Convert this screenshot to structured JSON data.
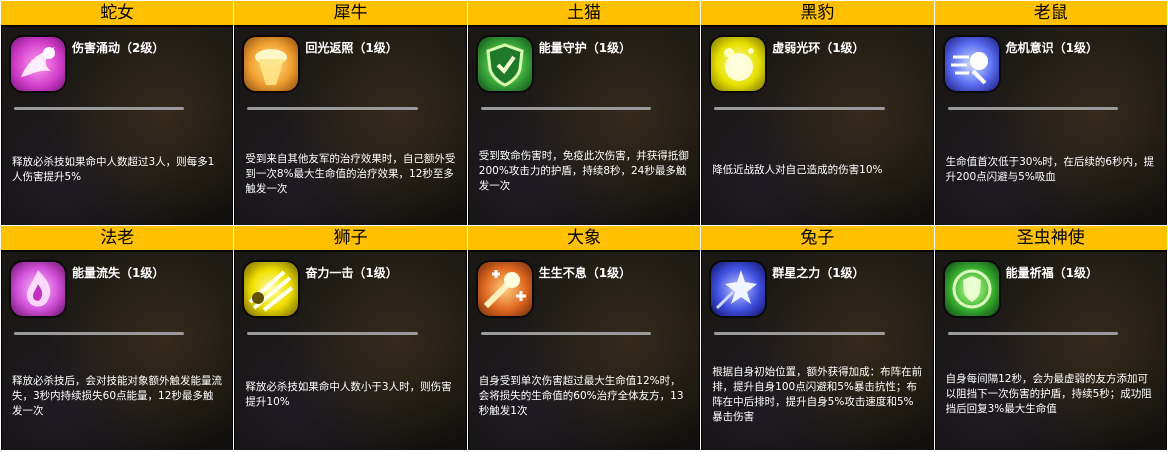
{
  "cards": [
    {
      "name": "蛇女",
      "skill": "伤害涌动（2级）",
      "description": "释放必杀技如果命中人数超过3人，则每多1人伤害提升5%",
      "icon": "swirl-burst-icon",
      "color": "#d03cc8"
    },
    {
      "name": "犀牛",
      "skill": "回光返照（1级）",
      "description": "受到来自其他友军的治疗效果时，自己额外受到一次8%最大生命值的治疗效果，12秒至多触发一次",
      "icon": "light-beam-icon",
      "color": "#f0a030"
    },
    {
      "name": "土猫",
      "skill": "能量守护（1级）",
      "description": "受到致命伤害时，免疫此次伤害，并获得抵御200%攻击力的护盾，持续8秒，24秒最多触发一次",
      "icon": "shield-icon",
      "color": "#3aa83a"
    },
    {
      "name": "黑豹",
      "skill": "虚弱光环（1级）",
      "description": "降低近战敌人对自己造成的伤害10%",
      "icon": "glow-orb-icon",
      "color": "#e6e000"
    },
    {
      "name": "老鼠",
      "skill": "危机意识（1级）",
      "description": "生命值首次低于30%时，在后续的6秒内，提升200点闪避与5%吸血",
      "icon": "dash-runner-icon",
      "color": "#5a6cf0"
    },
    {
      "name": "法老",
      "skill": "能量流失（1级）",
      "description": "释放必杀技后，会对技能对象额外触发能量流失，3秒内持续损失60点能量，12秒最多触发一次",
      "icon": "flame-drain-icon",
      "color": "#d050d8"
    },
    {
      "name": "狮子",
      "skill": "奋力一击（1级）",
      "description": "释放必杀技如果命中人数小于3人时，则伤害提升10%",
      "icon": "strike-rays-icon",
      "color": "#f0e000"
    },
    {
      "name": "大象",
      "skill": "生生不息（1级）",
      "description": "自身受到单次伤害超过最大生命值12%时，会将损失的生命值的60%治疗全体友方，13秒触发1次",
      "icon": "comet-heal-icon",
      "color": "#e06820"
    },
    {
      "name": "兔子",
      "skill": "群星之力（1级）",
      "description": "根据自身初始位置，额外获得加成：布阵在前排，提升自身100点闪避和5%暴击抗性；布阵在中后排时，提升自身5%攻击速度和5%暴击伤害",
      "icon": "star-burst-icon",
      "color": "#4050e0"
    },
    {
      "name": "圣虫神使",
      "skill": "能量祈福（1级）",
      "description": "自身每间隔12秒，会为最虚弱的友方添加可以阻挡下一次伤害的护盾，持续5秒；成功阻挡后回复3%最大生命值",
      "icon": "emblem-shield-icon",
      "color": "#38b030"
    }
  ]
}
